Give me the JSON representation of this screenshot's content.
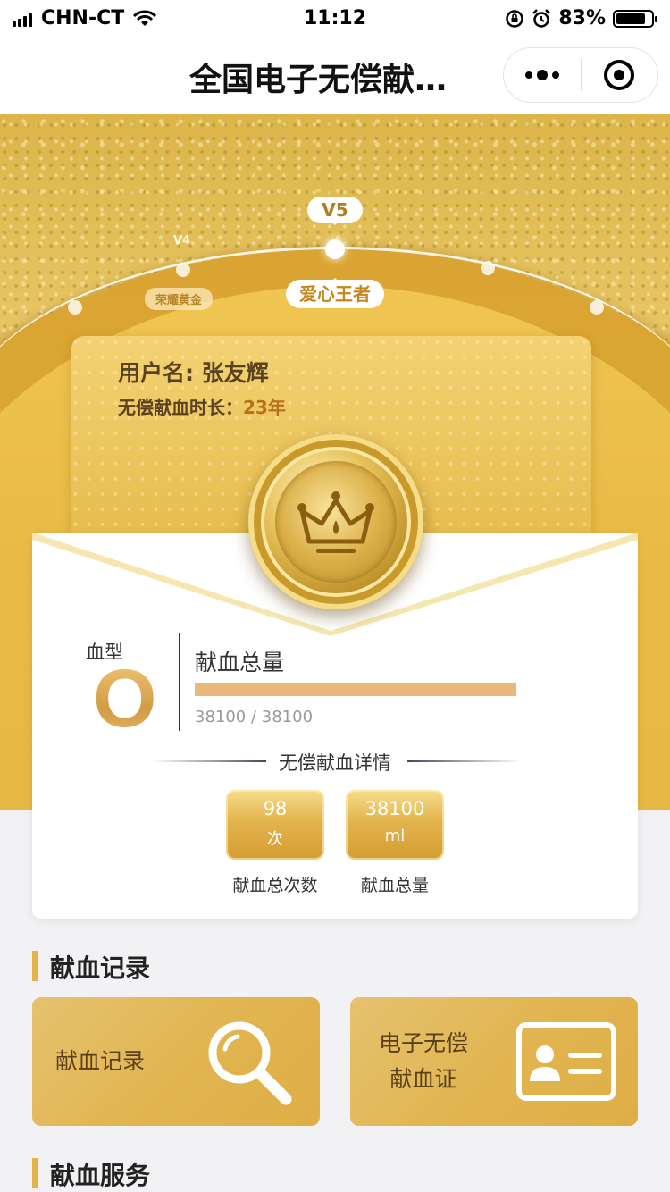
{
  "status_bar": {
    "carrier": "CHN-CT",
    "time": "11:12",
    "battery": "83%",
    "battery_level": 0.83,
    "icons": [
      "signal-icon",
      "wifi-icon",
      "orientation-lock-icon",
      "alarm-icon",
      "battery-icon"
    ]
  },
  "nav": {
    "title": "全国电子无偿献…",
    "more_icon": "more-dots-icon",
    "close_icon": "mini-program-close-icon"
  },
  "levels": {
    "current": "V5",
    "current_name": "爱心王者",
    "previous": "V4",
    "previous_name": "荣耀黄金"
  },
  "user": {
    "name_line": "用户名: 张友辉",
    "duration_label": "无偿献血时长：",
    "duration_value": "23年"
  },
  "blood": {
    "type_label": "血型",
    "type_value": "O",
    "volume_label": "献血总量",
    "volume_text": "38100 / 38100",
    "volume_progress": 1.0
  },
  "details": {
    "title": "无偿献血详情",
    "stats": [
      {
        "value": "98",
        "unit": "次",
        "caption": "献血总次数"
      },
      {
        "value": "38100",
        "unit": "ml",
        "caption": "献血总量"
      }
    ]
  },
  "sections": {
    "records_title": "献血记录",
    "services_title": "献血服务",
    "tiles": [
      {
        "label": "献血记录",
        "icon": "magnifier-icon"
      },
      {
        "label_line1": "电子无偿",
        "label_line2": "献血证",
        "icon": "id-card-icon"
      }
    ]
  },
  "colors": {
    "gold": "#e3b44c",
    "accent_text": "#b5711d",
    "progress": "#e9b87a"
  }
}
